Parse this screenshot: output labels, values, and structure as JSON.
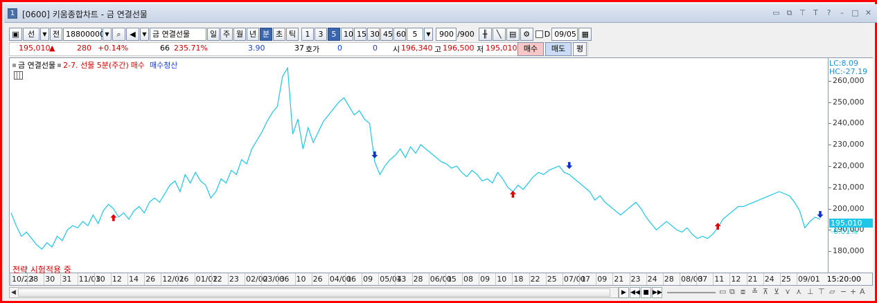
{
  "window": {
    "number": "1",
    "title": "[0600] 키움종합차트 - 금 연결선물"
  },
  "toolbar": {
    "type_select": "선",
    "prev_button": "전",
    "code_input": "18800000",
    "name_field": "금 연결선물",
    "periods": [
      "일",
      "주",
      "월",
      "년",
      "분",
      "초",
      "틱"
    ],
    "selected_period": "분",
    "quick_intervals": [
      "1",
      "3",
      "5",
      "10",
      "15",
      "30",
      "45",
      "60"
    ],
    "selected_interval": "5",
    "interval_select": "5",
    "count_input": "900",
    "count_total": "/900",
    "checkbox_label": "D",
    "date_input": "09/05"
  },
  "quote": {
    "price": "195,010",
    "arrow": "▲",
    "change": "280",
    "change_pct": "+0.14%",
    "volume": "66",
    "volume_pct": "235.71%",
    "value": "3.90",
    "hoga_count": "37",
    "hoga_label": "호가",
    "bid": "0",
    "ask": "0",
    "open_label": "시",
    "open": "196,340",
    "high_label": "고",
    "high": "196,500",
    "low_label": "저",
    "low": "195,010",
    "buy_button": "매수",
    "sell_button": "매도",
    "avg_button": "평"
  },
  "chart_panel": {
    "legend_name": "금 연결선물",
    "strategy_name": "2-7. 선물 5분(주간)",
    "buy_label": "매수",
    "sell_label": "매수청산",
    "strategy_status": "전략 시험적용 중",
    "lc": "LC:8.09",
    "hc": "HC:-27.19",
    "current_price": "195,010",
    "current_pct": "-0.01%",
    "time_label": "15:20:00"
  },
  "colors": {
    "line": "#1bc6e8",
    "buy_arrow": "#e00000",
    "sell_arrow": "#1030d0"
  },
  "chart_data": {
    "type": "line",
    "ylim": [
      170000,
      270000
    ],
    "y_ticks": [
      "260,000",
      "250,000",
      "240,000",
      "230,000",
      "220,000",
      "210,000",
      "200,000",
      "190,000",
      "180,000"
    ],
    "x_labels": [
      "10/23",
      "28",
      "30",
      "31",
      "11/03",
      "10",
      "12",
      "14",
      "26",
      "12/01",
      "26",
      "01/02",
      "12",
      "23",
      "02/02",
      "03/03",
      "06",
      "10",
      "26",
      "04/01",
      "06",
      "09",
      "05/04",
      "13",
      "28",
      "06/01",
      "05",
      "08",
      "09",
      "10",
      "18",
      "22",
      "25",
      "07/01",
      "07",
      "09",
      "21",
      "23",
      "24",
      "28",
      "08/03",
      "07",
      "11",
      "12",
      "21",
      "24",
      "25",
      "09/01"
    ],
    "series": [
      {
        "values": [
          198000,
          192000,
          187000,
          189000,
          186000,
          183000,
          181000,
          184000,
          182000,
          187000,
          185000,
          190000,
          192000,
          191000,
          194000,
          192000,
          197000,
          193000,
          199000,
          202000,
          200000,
          196000,
          198000,
          195000,
          199000,
          201000,
          198000,
          203000,
          205000,
          203000,
          207000,
          211000,
          213000,
          208000,
          216000,
          212000,
          217000,
          213000,
          211000,
          205000,
          208000,
          214000,
          212000,
          218000,
          216000,
          223000,
          221000,
          228000,
          232000,
          236000,
          241000,
          245000,
          248000,
          262000,
          266000,
          235000,
          242000,
          228000,
          238000,
          231000,
          236000,
          241000,
          244000,
          247000,
          250000,
          252000,
          248000,
          244000,
          246000,
          242000,
          240000,
          222000,
          216000,
          220000,
          223000,
          225000,
          228000,
          224000,
          229000,
          226000,
          230000,
          228000,
          226000,
          224000,
          222000,
          221000,
          219000,
          220000,
          217000,
          215000,
          218000,
          216000,
          213000,
          214000,
          212000,
          217000,
          214000,
          210000,
          208000,
          211000,
          209000,
          212000,
          215000,
          217000,
          216000,
          218000,
          219000,
          220000,
          217000,
          216000,
          214000,
          212000,
          210000,
          208000,
          204000,
          206000,
          203000,
          201000,
          199000,
          197000,
          199000,
          201000,
          203000,
          200000,
          196000,
          193000,
          190000,
          192000,
          194000,
          192000,
          190000,
          189000,
          191000,
          188000,
          186000,
          187000,
          186000,
          188000,
          191000,
          195000,
          197000,
          199000,
          201000,
          201000,
          202000,
          203000,
          204000,
          205000,
          206000,
          207000,
          208000,
          207000,
          206000,
          203000,
          199000,
          191000,
          194000,
          196000,
          195010
        ]
      }
    ],
    "markers": [
      {
        "type": "buy",
        "index": 20,
        "price": 199000
      },
      {
        "type": "sell",
        "index": 71,
        "price": 222000
      },
      {
        "type": "buy",
        "index": 98,
        "price": 210000
      },
      {
        "type": "sell",
        "index": 109,
        "price": 217000
      },
      {
        "type": "buy",
        "index": 138,
        "price": 195000
      },
      {
        "type": "sell",
        "index": 158,
        "price": 194000
      }
    ]
  }
}
